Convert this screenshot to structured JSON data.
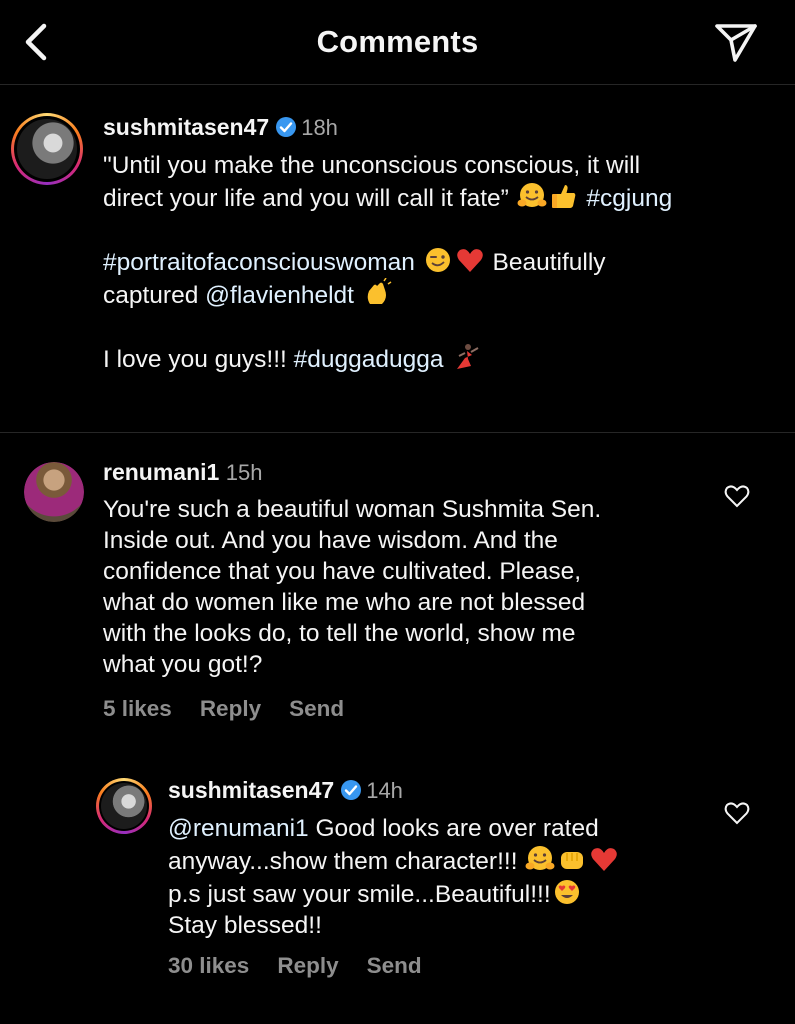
{
  "header": {
    "title": "Comments"
  },
  "caption": {
    "username": "sushmitasen47",
    "time": "18h",
    "line1": "\"Until you make the unconscious conscious, it will",
    "line2_text": "direct your life and you will call it fate”",
    "line2_tag": "#cgjung",
    "line3_tag": "#portraitofaconsciouswoman",
    "line3_text": "Beautifully",
    "line4_text": "captured",
    "line4_mention": "@flavienheldt",
    "line5_text": "I love you guys!!!",
    "line5_tag": "#duggadugga"
  },
  "comments": [
    {
      "username": "renumani1",
      "time": "15h",
      "lines": [
        "You're such a beautiful woman Sushmita Sen.",
        "Inside out. And you have wisdom. And the",
        "confidence that you have cultivated. Please,",
        "what do women like me who are not blessed",
        "with the looks do, to tell the world, show me",
        "what you got!?"
      ],
      "likes": "5 likes",
      "reply": "Reply",
      "send": "Send"
    }
  ],
  "reply": {
    "username": "sushmitasen47",
    "time": "14h",
    "mention": "@renumani1",
    "line1_text": "Good looks are over rated",
    "line2_text": "anyway...show them character!!!",
    "line3_text": "p.s just saw your smile...Beautiful!!!",
    "line4_text": "Stay blessed!!",
    "likes": "30 likes",
    "reply_label": "Reply",
    "send_label": "Send"
  },
  "colors": {
    "background": "#000000",
    "text": "#f5f5f5",
    "secondary": "#a8a8a8",
    "verified": "#3897f0",
    "hashtag": "#e0f1ff"
  },
  "icons": [
    "back-arrow-icon",
    "direct-send-icon",
    "verified-badge-icon",
    "heart-outline-icon"
  ]
}
